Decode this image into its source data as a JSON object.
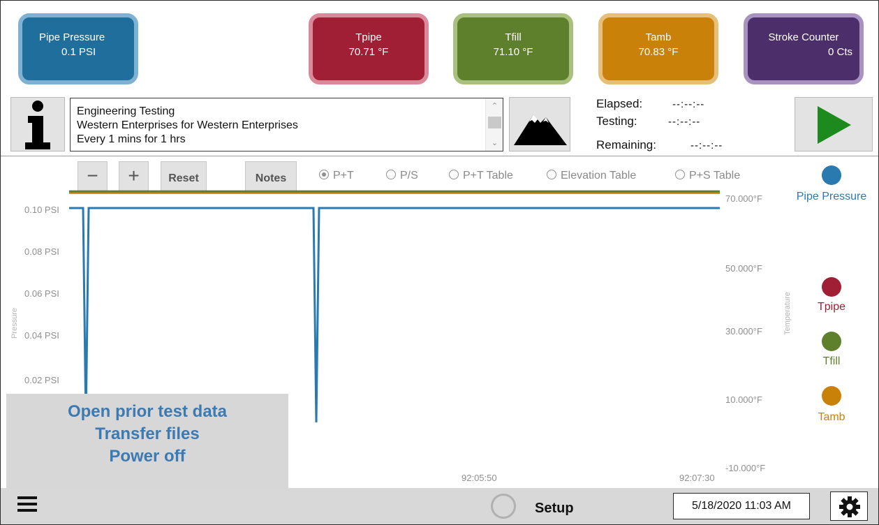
{
  "tiles": [
    {
      "label": "Pipe Pressure",
      "value": "0.1 PSI",
      "color": "#1f6e9c",
      "border": "#7fb1d2"
    },
    {
      "label": "Tpipe",
      "value": "70.71 °F",
      "color": "#a01f34",
      "border": "#d9899a"
    },
    {
      "label": "Tfill",
      "value": "71.10 °F",
      "color": "#5e7f2c",
      "border": "#a9c07e"
    },
    {
      "label": "Tamb",
      "value": "70.83 °F",
      "color": "#c98109",
      "border": "#e6bf7a"
    },
    {
      "label": "Stroke Counter",
      "value": "0 Cts",
      "color": "#4c2f6a",
      "border": "#a892c0"
    }
  ],
  "info": {
    "lines": [
      "Engineering Testing",
      "Western Enterprises for Western Enterprises",
      "Every 1 mins for 1 hrs"
    ]
  },
  "timers": {
    "elapsed_label": "Elapsed:",
    "elapsed_value": "--:--:--",
    "testing_label": "Testing:",
    "testing_value": "--:--:--",
    "remaining_label": "Remaining:",
    "remaining_value": "--:--:--"
  },
  "toolbar": {
    "minus": "−",
    "plus": "+",
    "reset": "Reset",
    "notes": "Notes",
    "radios": [
      {
        "label": "P+T",
        "selected": true
      },
      {
        "label": "P/S",
        "selected": false
      },
      {
        "label": "P+T Table",
        "selected": false
      },
      {
        "label": "Elevation Table",
        "selected": false
      },
      {
        "label": "P+S Table",
        "selected": false
      }
    ]
  },
  "chart_data": {
    "type": "line",
    "ylabel": "Pressure",
    "y2label": "Temperature",
    "y_ticks": [
      "0.10 PSI",
      "0.08 PSI",
      "0.06 PSI",
      "0.04 PSI",
      "0.02 PSI"
    ],
    "y2_ticks": [
      "70.000°F",
      "50.000°F",
      "30.000°F",
      "10.000°F",
      "-10.000°F"
    ],
    "x_ticks": [
      "92:05:50",
      "92:07:30"
    ],
    "series": [
      {
        "name": "Pipe Pressure",
        "color": "#2a7ab0",
        "axis": "pressure",
        "values": [
          0.1,
          0.1,
          0.0,
          0.1,
          0.1,
          0.1,
          0.0,
          0.1,
          0.1
        ]
      },
      {
        "name": "Tpipe",
        "color": "#a01f34",
        "axis": "temperature",
        "values": [
          70.7,
          70.7
        ]
      },
      {
        "name": "Tfill",
        "color": "#5e7f2c",
        "axis": "temperature",
        "values": [
          71.1,
          71.1
        ]
      },
      {
        "name": "Tamb",
        "color": "#c98109",
        "axis": "temperature",
        "values": [
          70.8,
          70.8
        ]
      }
    ],
    "legend_position": "right"
  },
  "legend": [
    {
      "label": "Pipe Pressure",
      "color": "#2a7ab0"
    },
    {
      "label": "Tpipe",
      "color": "#a01f34"
    },
    {
      "label": "Tfill",
      "color": "#5e7f2c"
    },
    {
      "label": "Tamb",
      "color": "#c98109"
    }
  ],
  "menu": {
    "items": [
      "Open prior test data",
      "Transfer files",
      "Power off"
    ]
  },
  "bottom": {
    "setup_label": "Setup",
    "datetime": "5/18/2020 11:03 AM"
  }
}
